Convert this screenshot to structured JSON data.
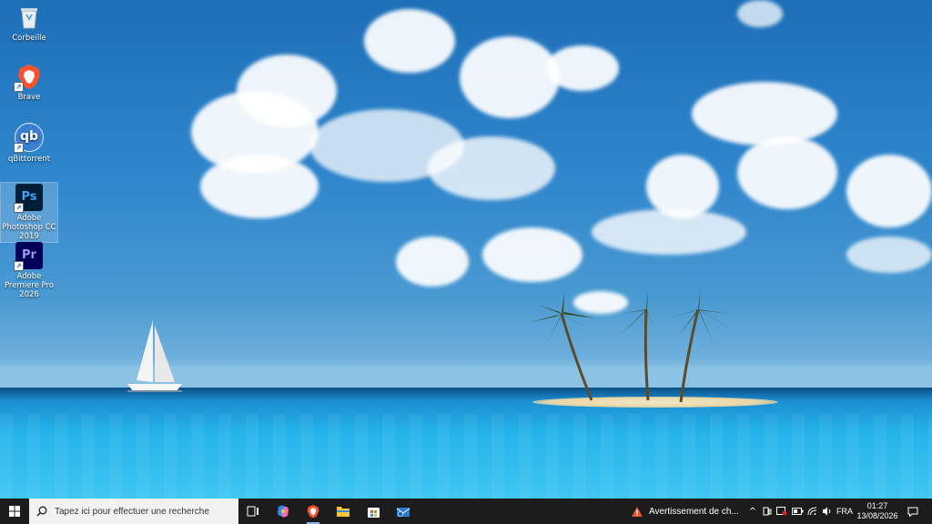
{
  "desktop": {
    "icons": [
      {
        "label": "Corbeille",
        "icon": "recycle-bin-icon"
      },
      {
        "label": "Brave",
        "icon": "brave-icon"
      },
      {
        "label": "qBittorrent",
        "icon": "qbittorrent-icon"
      },
      {
        "label": "Adobe Photoshop CC 2019",
        "icon": "photoshop-icon",
        "glyph": "Ps"
      },
      {
        "label": "Adobe Premiere Pro 2026",
        "icon": "premiere-icon",
        "glyph": "Pr"
      }
    ],
    "qb_glyph": "qb"
  },
  "taskbar": {
    "search_placeholder": "Tapez ici pour effectuer une recherche",
    "notification_text": "Avertissement de ch...",
    "language": "FRA",
    "time": "01:27",
    "date": "13/08/2026",
    "apps": [
      "task-view-icon",
      "copilot-icon",
      "brave-icon",
      "file-explorer-icon",
      "store-icon",
      "mail-icon"
    ]
  },
  "colors": {
    "taskbar_bg": "#1c1c1c",
    "search_bg": "#f2f2f2",
    "brave_orange": "#fb542b",
    "photoshop_bg": "#001e36",
    "photoshop_fg": "#31a8ff",
    "premiere_bg": "#00005b",
    "premiere_fg": "#9999ff",
    "qbittorrent_blue": "#3b7fd4"
  }
}
